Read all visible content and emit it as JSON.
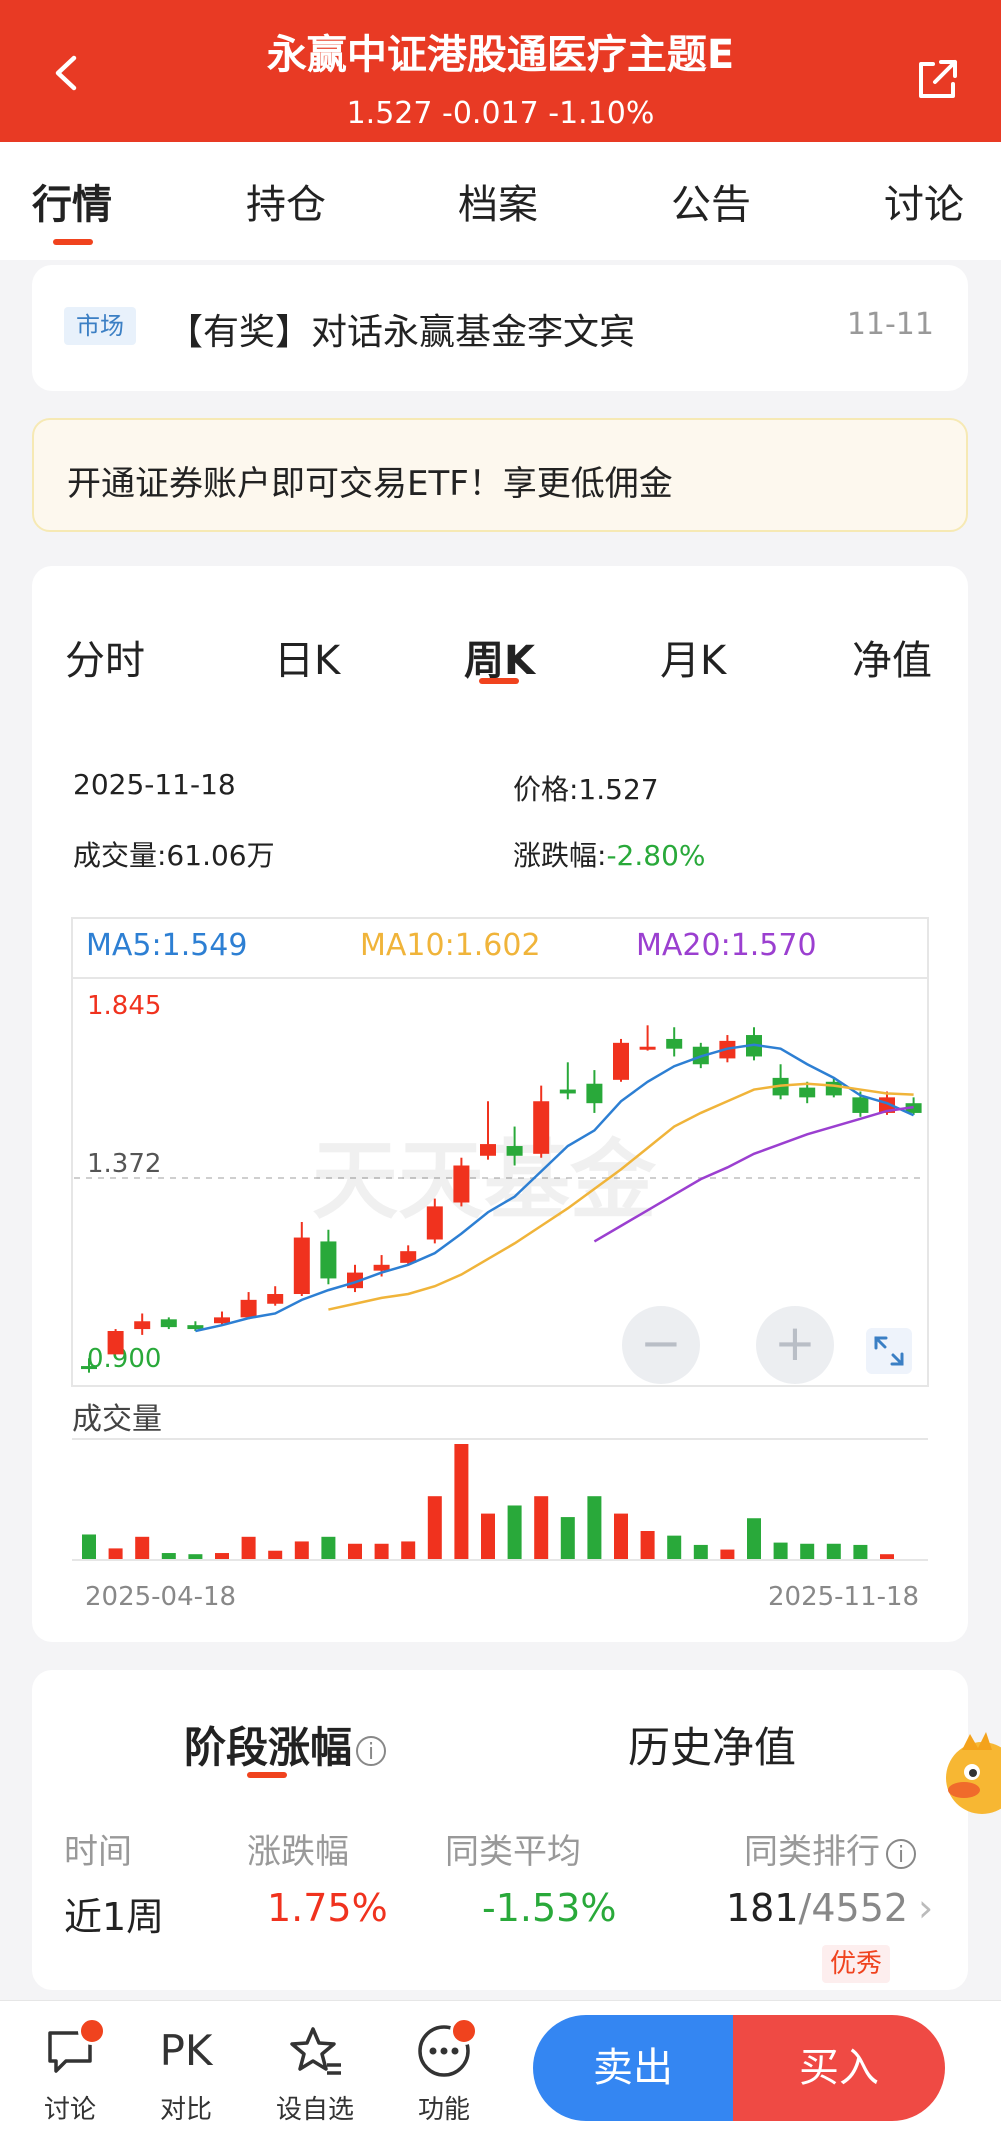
{
  "header": {
    "title": "永赢中证港股通医疗主题E",
    "price_line": "1.527 -0.017 -1.10%"
  },
  "tabs": [
    "行情",
    "持仓",
    "档案",
    "公告",
    "讨论"
  ],
  "news": {
    "tag": "市场",
    "title": "【有奖】对话永赢基金李文宾",
    "date": "11-11"
  },
  "promo": {
    "text": "开通证券账户即可交易ETF！享更低佣金"
  },
  "kline_tabs": [
    "分时",
    "日K",
    "周K",
    "月K",
    "净值"
  ],
  "quote": {
    "date": "2025-11-18",
    "price": "价格:1.527",
    "volume": "成交量:61.06万",
    "change_label": "涨跌幅:",
    "change_value": "-2.80%"
  },
  "ma": {
    "ma5": "MA5:1.549",
    "ma10": "MA10:1.602",
    "ma20": "MA20:1.570"
  },
  "colors": {
    "up": "#f0321e",
    "down": "#29a93a",
    "ma5": "#2d7fd3",
    "ma10": "#f0b43a",
    "ma20": "#9b3fd0",
    "accent": "#e83a24",
    "sell": "#3486f2",
    "buy": "#ef4a44"
  },
  "chart_data": {
    "type": "candlestick",
    "y_labels": {
      "max": "1.845",
      "mid": "1.372",
      "min": "0.900"
    },
    "ylim": [
      0.9,
      1.845
    ],
    "x_start": "2025-04-18",
    "x_end": "2025-11-18",
    "volume_label": "成交量",
    "watermark": "天天基金",
    "candles": [
      {
        "o": 0.905,
        "c": 0.905,
        "h": 0.925,
        "l": 0.888,
        "up": false
      },
      {
        "o": 0.935,
        "c": 0.995,
        "h": 1.0,
        "l": 0.935,
        "up": true
      },
      {
        "o": 1.0,
        "c": 1.02,
        "h": 1.04,
        "l": 0.985,
        "up": true
      },
      {
        "o": 1.025,
        "c": 1.005,
        "h": 1.03,
        "l": 1.0,
        "up": false
      },
      {
        "o": 1.01,
        "c": 1.0,
        "h": 1.02,
        "l": 0.995,
        "up": false
      },
      {
        "o": 1.015,
        "c": 1.03,
        "h": 1.045,
        "l": 1.01,
        "up": true
      },
      {
        "o": 1.03,
        "c": 1.075,
        "h": 1.095,
        "l": 1.025,
        "up": true
      },
      {
        "o": 1.065,
        "c": 1.09,
        "h": 1.11,
        "l": 1.06,
        "up": true
      },
      {
        "o": 1.09,
        "c": 1.235,
        "h": 1.275,
        "l": 1.085,
        "up": true
      },
      {
        "o": 1.225,
        "c": 1.13,
        "h": 1.255,
        "l": 1.115,
        "up": false
      },
      {
        "o": 1.105,
        "c": 1.145,
        "h": 1.165,
        "l": 1.095,
        "up": true
      },
      {
        "o": 1.15,
        "c": 1.165,
        "h": 1.19,
        "l": 1.135,
        "up": true
      },
      {
        "o": 1.17,
        "c": 1.2,
        "h": 1.215,
        "l": 1.165,
        "up": true
      },
      {
        "o": 1.23,
        "c": 1.315,
        "h": 1.335,
        "l": 1.22,
        "up": true
      },
      {
        "o": 1.325,
        "c": 1.42,
        "h": 1.44,
        "l": 1.315,
        "up": true
      },
      {
        "o": 1.445,
        "c": 1.475,
        "h": 1.585,
        "l": 1.435,
        "up": true
      },
      {
        "o": 1.47,
        "c": 1.445,
        "h": 1.52,
        "l": 1.42,
        "up": false
      },
      {
        "o": 1.45,
        "c": 1.585,
        "h": 1.625,
        "l": 1.44,
        "up": true
      },
      {
        "o": 1.615,
        "c": 1.605,
        "h": 1.685,
        "l": 1.59,
        "up": false
      },
      {
        "o": 1.63,
        "c": 1.58,
        "h": 1.665,
        "l": 1.555,
        "up": false
      },
      {
        "o": 1.64,
        "c": 1.735,
        "h": 1.745,
        "l": 1.635,
        "up": true
      },
      {
        "o": 1.72,
        "c": 1.725,
        "h": 1.78,
        "l": 1.715,
        "up": true
      },
      {
        "o": 1.745,
        "c": 1.72,
        "h": 1.775,
        "l": 1.7,
        "up": false
      },
      {
        "o": 1.725,
        "c": 1.68,
        "h": 1.735,
        "l": 1.67,
        "up": false
      },
      {
        "o": 1.695,
        "c": 1.74,
        "h": 1.755,
        "l": 1.685,
        "up": true
      },
      {
        "o": 1.755,
        "c": 1.7,
        "h": 1.775,
        "l": 1.69,
        "up": false
      },
      {
        "o": 1.645,
        "c": 1.6,
        "h": 1.68,
        "l": 1.59,
        "up": false
      },
      {
        "o": 1.62,
        "c": 1.595,
        "h": 1.635,
        "l": 1.58,
        "up": false
      },
      {
        "o": 1.635,
        "c": 1.6,
        "h": 1.645,
        "l": 1.595,
        "up": false
      },
      {
        "o": 1.595,
        "c": 1.555,
        "h": 1.61,
        "l": 1.545,
        "up": false
      },
      {
        "o": 1.555,
        "c": 1.595,
        "h": 1.61,
        "l": 1.55,
        "up": true
      },
      {
        "o": 1.58,
        "c": 1.555,
        "h": 1.595,
        "l": 1.55,
        "up": false
      }
    ],
    "ma5": [
      null,
      null,
      null,
      null,
      0.995,
      1.01,
      1.028,
      1.04,
      1.075,
      1.1,
      1.12,
      1.145,
      1.165,
      1.195,
      1.245,
      1.3,
      1.34,
      1.405,
      1.47,
      1.51,
      1.585,
      1.635,
      1.675,
      1.7,
      1.72,
      1.73,
      1.72,
      1.68,
      1.645,
      1.6,
      1.58,
      1.549
    ],
    "ma10": [
      null,
      null,
      null,
      null,
      null,
      null,
      null,
      null,
      null,
      1.05,
      1.065,
      1.08,
      1.09,
      1.11,
      1.14,
      1.18,
      1.22,
      1.265,
      1.31,
      1.36,
      1.41,
      1.465,
      1.52,
      1.555,
      1.585,
      1.615,
      1.625,
      1.63,
      1.625,
      1.615,
      1.605,
      1.602
    ],
    "ma20": [
      null,
      null,
      null,
      null,
      null,
      null,
      null,
      null,
      null,
      null,
      null,
      null,
      null,
      null,
      null,
      null,
      null,
      null,
      null,
      1.225,
      1.265,
      1.305,
      1.345,
      1.385,
      1.415,
      1.45,
      1.475,
      1.5,
      1.52,
      1.54,
      1.56,
      1.57
    ],
    "volumes": [
      22,
      10,
      20,
      6,
      5,
      6,
      20,
      8,
      16,
      20,
      14,
      14,
      16,
      55,
      100,
      40,
      47,
      55,
      37,
      55,
      40,
      25,
      21,
      13,
      9,
      36,
      15,
      14,
      14,
      13,
      5
    ]
  },
  "period": {
    "tabs": [
      "阶段涨幅",
      "历史净值"
    ],
    "info_icon": "i",
    "headers": [
      "时间",
      "涨跌幅",
      "同类平均",
      "同类排行"
    ],
    "row": {
      "period": "近1周",
      "change": "1.75%",
      "avg": "-1.53%",
      "rank": "181",
      "total": "/4552",
      "badge": "优秀"
    }
  },
  "bottom": {
    "items": [
      "讨论",
      "对比",
      "设自选",
      "功能"
    ],
    "pk": "PK",
    "sell": "卖出",
    "buy": "买入"
  }
}
